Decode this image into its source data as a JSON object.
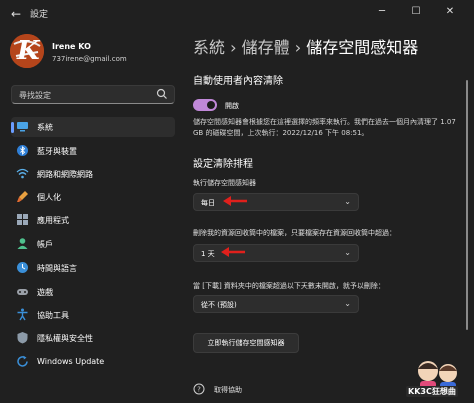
{
  "window": {
    "title": "設定",
    "back_icon": "back-arrow-icon",
    "controls": [
      "minimize",
      "maximize",
      "close"
    ]
  },
  "profile": {
    "avatar_letter": "K",
    "name": "Irene KO",
    "email": "737irene@gmail.com"
  },
  "search": {
    "placeholder": "尋找設定"
  },
  "sidebar": {
    "items": [
      {
        "label": "系統",
        "icon": "monitor-icon",
        "active": true
      },
      {
        "label": "藍牙與裝置",
        "icon": "bluetooth-icon"
      },
      {
        "label": "網路和網際網路",
        "icon": "wifi-icon"
      },
      {
        "label": "個人化",
        "icon": "brush-icon"
      },
      {
        "label": "應用程式",
        "icon": "apps-icon"
      },
      {
        "label": "帳戶",
        "icon": "person-icon"
      },
      {
        "label": "時間與語言",
        "icon": "globe-clock-icon"
      },
      {
        "label": "遊戲",
        "icon": "gamepad-icon"
      },
      {
        "label": "協助工具",
        "icon": "accessibility-icon"
      },
      {
        "label": "隱私權與安全性",
        "icon": "shield-icon"
      },
      {
        "label": "Windows Update",
        "icon": "update-icon"
      }
    ]
  },
  "breadcrumb": {
    "part1": "系統",
    "sep1": "›",
    "part2": "儲存體",
    "sep2": "›",
    "part3": "儲存空間感知器"
  },
  "auto_cleanup": {
    "title": "自動使用者內容清除",
    "toggle_label": "開啟",
    "toggle_on": true,
    "description": "儲存空間感知器會根據您在這裡選擇的頻率來執行。我們在過去一個月內清理了 1.07 GB 的磁碟空間，上次執行：2022/12/16 下午 08:51。"
  },
  "schedule": {
    "title": "設定清除排程",
    "run_label": "執行儲存空間感知器",
    "run_value": "每日",
    "recycle_label": "刪除我的資源回收筒中的檔案，只要檔案存在資源回收筒中超過：",
    "recycle_value": "1 天",
    "downloads_label": "當 [下載] 資料夾中的檔案超過以下天數未開啟，就予以刪除：",
    "downloads_value": "從不 (預設)",
    "run_now_button": "立即執行儲存空間感知器"
  },
  "help": {
    "label": "取得協助"
  },
  "watermark": {
    "text": "KK3C狂想曲"
  },
  "colors": {
    "background": "#202020",
    "toggle_on": "#c088d8",
    "accent": "#6a9dff",
    "annotation_arrow": "#e0201c"
  }
}
